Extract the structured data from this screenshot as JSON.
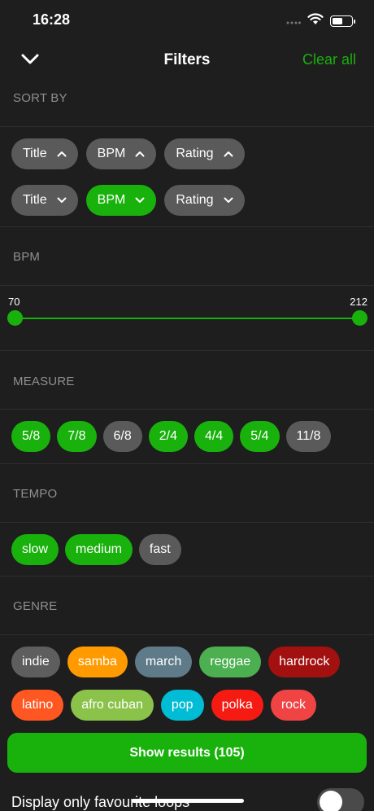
{
  "status": {
    "time": "16:28",
    "battery_level": 0.55
  },
  "nav": {
    "title": "Filters",
    "clear_all": "Clear all"
  },
  "sections": {
    "sort_by": "SORT BY",
    "bpm": "BPM",
    "measure": "MEASURE",
    "tempo": "TEMPO",
    "genre": "GENRE"
  },
  "sort_asc": [
    {
      "label": "Title",
      "active": false
    },
    {
      "label": "BPM",
      "active": false
    },
    {
      "label": "Rating",
      "active": false
    }
  ],
  "sort_desc": [
    {
      "label": "Title",
      "active": false
    },
    {
      "label": "BPM",
      "active": true
    },
    {
      "label": "Rating",
      "active": false
    }
  ],
  "bpm_range": {
    "min_label": "70",
    "max_label": "212",
    "min": 70,
    "max": 212,
    "low": 70,
    "high": 212
  },
  "measures": [
    {
      "label": "5/8",
      "active": true
    },
    {
      "label": "7/8",
      "active": true
    },
    {
      "label": "6/8",
      "active": false
    },
    {
      "label": "2/4",
      "active": true
    },
    {
      "label": "4/4",
      "active": true
    },
    {
      "label": "5/4",
      "active": true
    },
    {
      "label": "11/8",
      "active": false
    }
  ],
  "tempos": [
    {
      "label": "slow",
      "active": true
    },
    {
      "label": "medium",
      "active": true
    },
    {
      "label": "fast",
      "active": false
    }
  ],
  "genres_row1": [
    {
      "label": "indie",
      "color": "#5e5e5e"
    },
    {
      "label": "samba",
      "color": "#ff9a00"
    },
    {
      "label": "march",
      "color": "#5f7b8a"
    },
    {
      "label": "reggae",
      "color": "#4caf50"
    },
    {
      "label": "hardrock",
      "color": "#a31010"
    }
  ],
  "genres_row2": [
    {
      "label": "latino",
      "color": "#ff5722"
    },
    {
      "label": "afro cuban",
      "color": "#8bc34a"
    },
    {
      "label": "pop",
      "color": "#00bcd4"
    },
    {
      "label": "polka",
      "color": "#f51b12"
    },
    {
      "label": "rock",
      "color": "#f04343"
    }
  ],
  "show_results": "Show results (105)",
  "favourites": {
    "label": "Display only favourite loops",
    "on": false
  },
  "colors": {
    "accent": "#19b10c",
    "chip_inactive": "#5a5a5a"
  }
}
